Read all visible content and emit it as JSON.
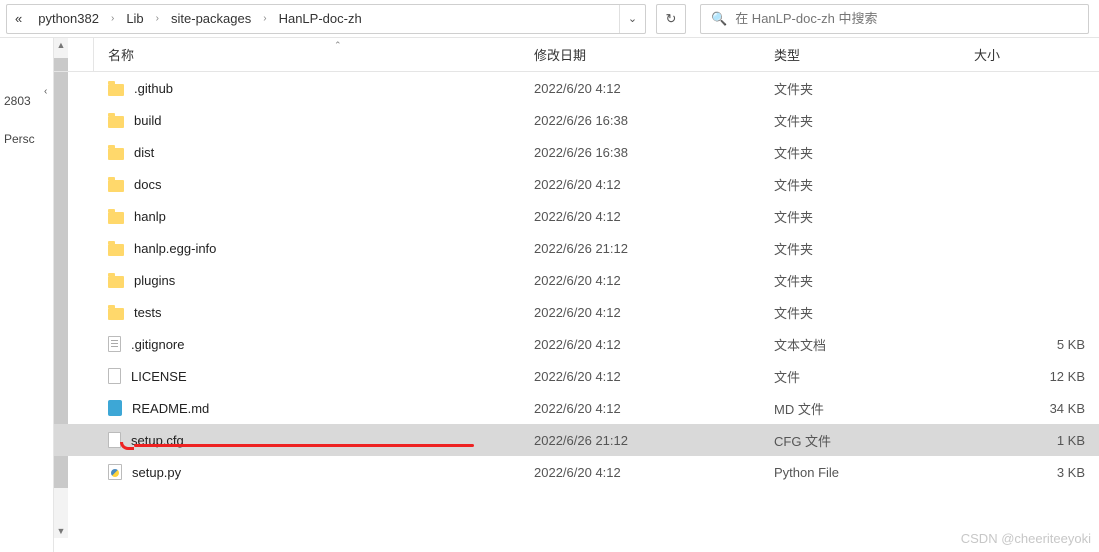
{
  "breadcrumb": {
    "back_indicator": "«",
    "items": [
      "python382",
      "Lib",
      "site-packages",
      "HanLP-doc-zh"
    ]
  },
  "search": {
    "placeholder": "在 HanLP-doc-zh 中搜索"
  },
  "leftnav": {
    "item1": "2803",
    "item2": "Persc"
  },
  "columns": {
    "name": "名称",
    "date": "修改日期",
    "type": "类型",
    "size": "大小"
  },
  "files": [
    {
      "icon": "folder",
      "name": ".github",
      "date": "2022/6/20 4:12",
      "type": "文件夹",
      "size": ""
    },
    {
      "icon": "folder",
      "name": "build",
      "date": "2022/6/26 16:38",
      "type": "文件夹",
      "size": ""
    },
    {
      "icon": "folder",
      "name": "dist",
      "date": "2022/6/26 16:38",
      "type": "文件夹",
      "size": ""
    },
    {
      "icon": "folder",
      "name": "docs",
      "date": "2022/6/20 4:12",
      "type": "文件夹",
      "size": ""
    },
    {
      "icon": "folder",
      "name": "hanlp",
      "date": "2022/6/20 4:12",
      "type": "文件夹",
      "size": ""
    },
    {
      "icon": "folder",
      "name": "hanlp.egg-info",
      "date": "2022/6/26 21:12",
      "type": "文件夹",
      "size": ""
    },
    {
      "icon": "folder",
      "name": "plugins",
      "date": "2022/6/20 4:12",
      "type": "文件夹",
      "size": ""
    },
    {
      "icon": "folder",
      "name": "tests",
      "date": "2022/6/20 4:12",
      "type": "文件夹",
      "size": ""
    },
    {
      "icon": "text",
      "name": ".gitignore",
      "date": "2022/6/20 4:12",
      "type": "文本文档",
      "size": "5 KB"
    },
    {
      "icon": "file",
      "name": "LICENSE",
      "date": "2022/6/20 4:12",
      "type": "文件",
      "size": "12 KB"
    },
    {
      "icon": "md",
      "name": "README.md",
      "date": "2022/6/20 4:12",
      "type": "MD 文件",
      "size": "34 KB"
    },
    {
      "icon": "file",
      "name": "setup.cfg",
      "date": "2022/6/26 21:12",
      "type": "CFG 文件",
      "size": "1 KB",
      "selected": true
    },
    {
      "icon": "py",
      "name": "setup.py",
      "date": "2022/6/20 4:12",
      "type": "Python File",
      "size": "3 KB"
    }
  ],
  "watermark": "CSDN @cheeriteeyoki"
}
